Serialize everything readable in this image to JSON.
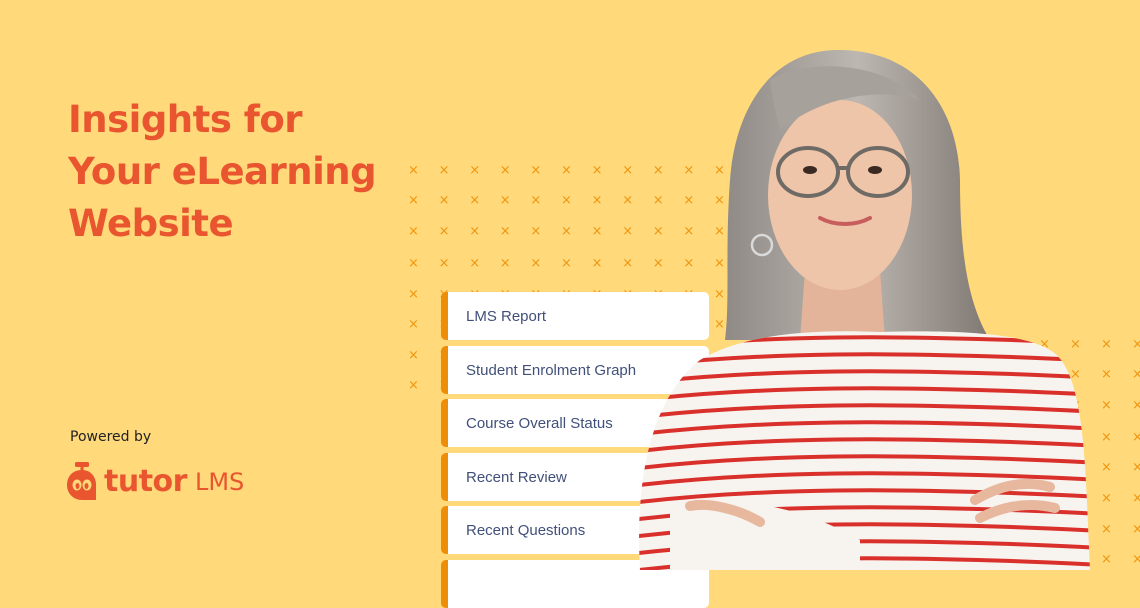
{
  "headline": {
    "lines": [
      "Insights for",
      "Your eLearning",
      "Website"
    ],
    "color": "#E9552F"
  },
  "powered_by": "Powered by",
  "logo": {
    "word": "tutor",
    "suffix": "LMS",
    "icon": "tutor-owl-icon",
    "color": "#E9552F"
  },
  "report_items": [
    {
      "label": "LMS Report"
    },
    {
      "label": "Student Enrolment Graph"
    },
    {
      "label": "Course Overall Status"
    },
    {
      "label": "Recent Review"
    },
    {
      "label": "Recent Questions"
    },
    {
      "label": ""
    }
  ],
  "colors": {
    "background": "#FFD97A",
    "accent": "#EE8D07",
    "card_text": "#41507A",
    "pattern": "#F0950E"
  },
  "decoration": {
    "pattern_glyph": "×",
    "photo": "smiling-woman-striped-shirt"
  }
}
